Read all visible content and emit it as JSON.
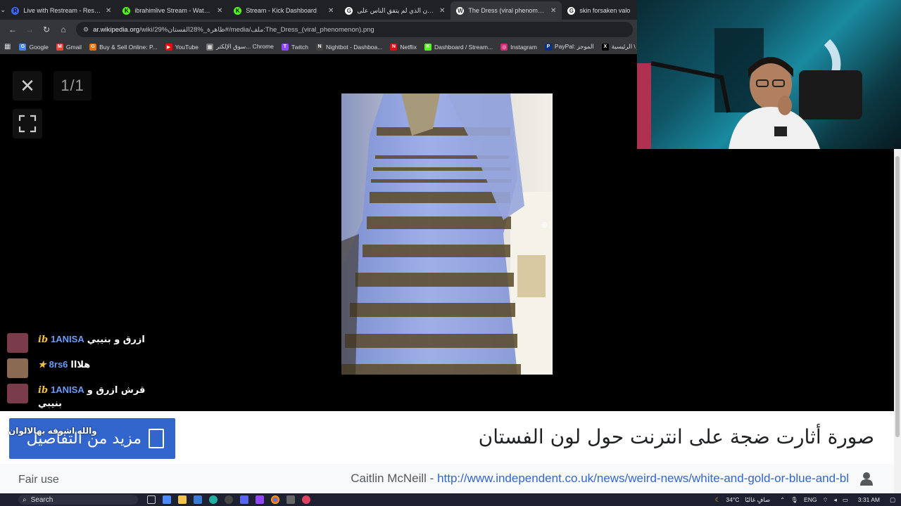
{
  "browser": {
    "tabs": [
      {
        "title": "Live with Restream - Restream",
        "fav_color": "#3b6bf6",
        "fav_text": "R",
        "active": false
      },
      {
        "title": "ibrahimlive Stream - Watch Live",
        "fav_color": "#53fc18",
        "fav_text": "K",
        "active": false
      },
      {
        "title": "Stream - Kick Dashboard",
        "fav_color": "#53fc18",
        "fav_text": "K",
        "active": false
      },
      {
        "title": "الفستان الذي لم يتفق الناس على",
        "fav_color": "#ffffff",
        "fav_text": "G",
        "active": false
      },
      {
        "title": "The Dress (viral phenomenon)",
        "fav_color": "#ffffff",
        "fav_text": "W",
        "active": true
      },
      {
        "title": "skin forsaken valo",
        "fav_color": "#ffffff",
        "fav_text": "G",
        "active": false
      }
    ],
    "url_host": "ar.wikipedia.org",
    "url_path": "/wiki/29%ظاهرة_%28الفستان#/media/ملف:The_Dress_(viral_phenomenon).png",
    "bookmarks": [
      {
        "label": "Google",
        "color": "#4285f4",
        "glyph": "G"
      },
      {
        "label": "Gmail",
        "color": "#ea4335",
        "glyph": "M"
      },
      {
        "label": "Buy & Sell Online: P...",
        "color": "#e8710a",
        "glyph": "G"
      },
      {
        "label": "YouTube",
        "color": "#ff0000",
        "glyph": "▶"
      },
      {
        "label": "سوق الإلكتر... Chrome",
        "color": "#777777",
        "glyph": "▦"
      },
      {
        "label": "Twitch",
        "color": "#9146ff",
        "glyph": "T"
      },
      {
        "label": "Nightbot - Dashboa...",
        "color": "#444444",
        "glyph": "N"
      },
      {
        "label": "Netflix",
        "color": "#e50914",
        "glyph": "N"
      },
      {
        "label": "Dashboard / Stream...",
        "color": "#53fc18",
        "glyph": "K"
      },
      {
        "label": "Instagram",
        "color": "#d62976",
        "glyph": "◎"
      },
      {
        "label": "PayPal: الموجز",
        "color": "#003087",
        "glyph": "P"
      },
      {
        "label": "تويتر \\ الرئيسية",
        "color": "#000000",
        "glyph": "X"
      }
    ]
  },
  "viewer": {
    "close_glyph": "✕",
    "counter": "1/1",
    "caption": "صورة أثارت ضجة على انترنت حول لون الفستان",
    "more_details": "مزيد من التفاصيل",
    "author": "Caitlin McNeill",
    "separator": " - ",
    "source_url": "http://www.independent.co.uk/news/weird-news/white-and-gold-or-blue-and-bl",
    "license": "Fair use"
  },
  "chat": {
    "messages": [
      {
        "badge": "ib",
        "user": "1ANISA",
        "text": "ازرق و بنيبي",
        "avatar": "#7a3b4a"
      },
      {
        "badge": "★",
        "user": "8rs6",
        "text": "هلااا",
        "avatar": "#8a6a50"
      },
      {
        "badge": "ib",
        "user": "1ANISA",
        "text": "قرش ازرق و بنيبي",
        "avatar": "#7a3b4a"
      }
    ],
    "ghost_message": "والله اشوفه بهالالوان"
  },
  "taskbar": {
    "search_placeholder": "Search",
    "temperature": "34°C",
    "weather": "صافٍ غالبًا",
    "lang": "ENG",
    "time": "3:31 AM"
  }
}
